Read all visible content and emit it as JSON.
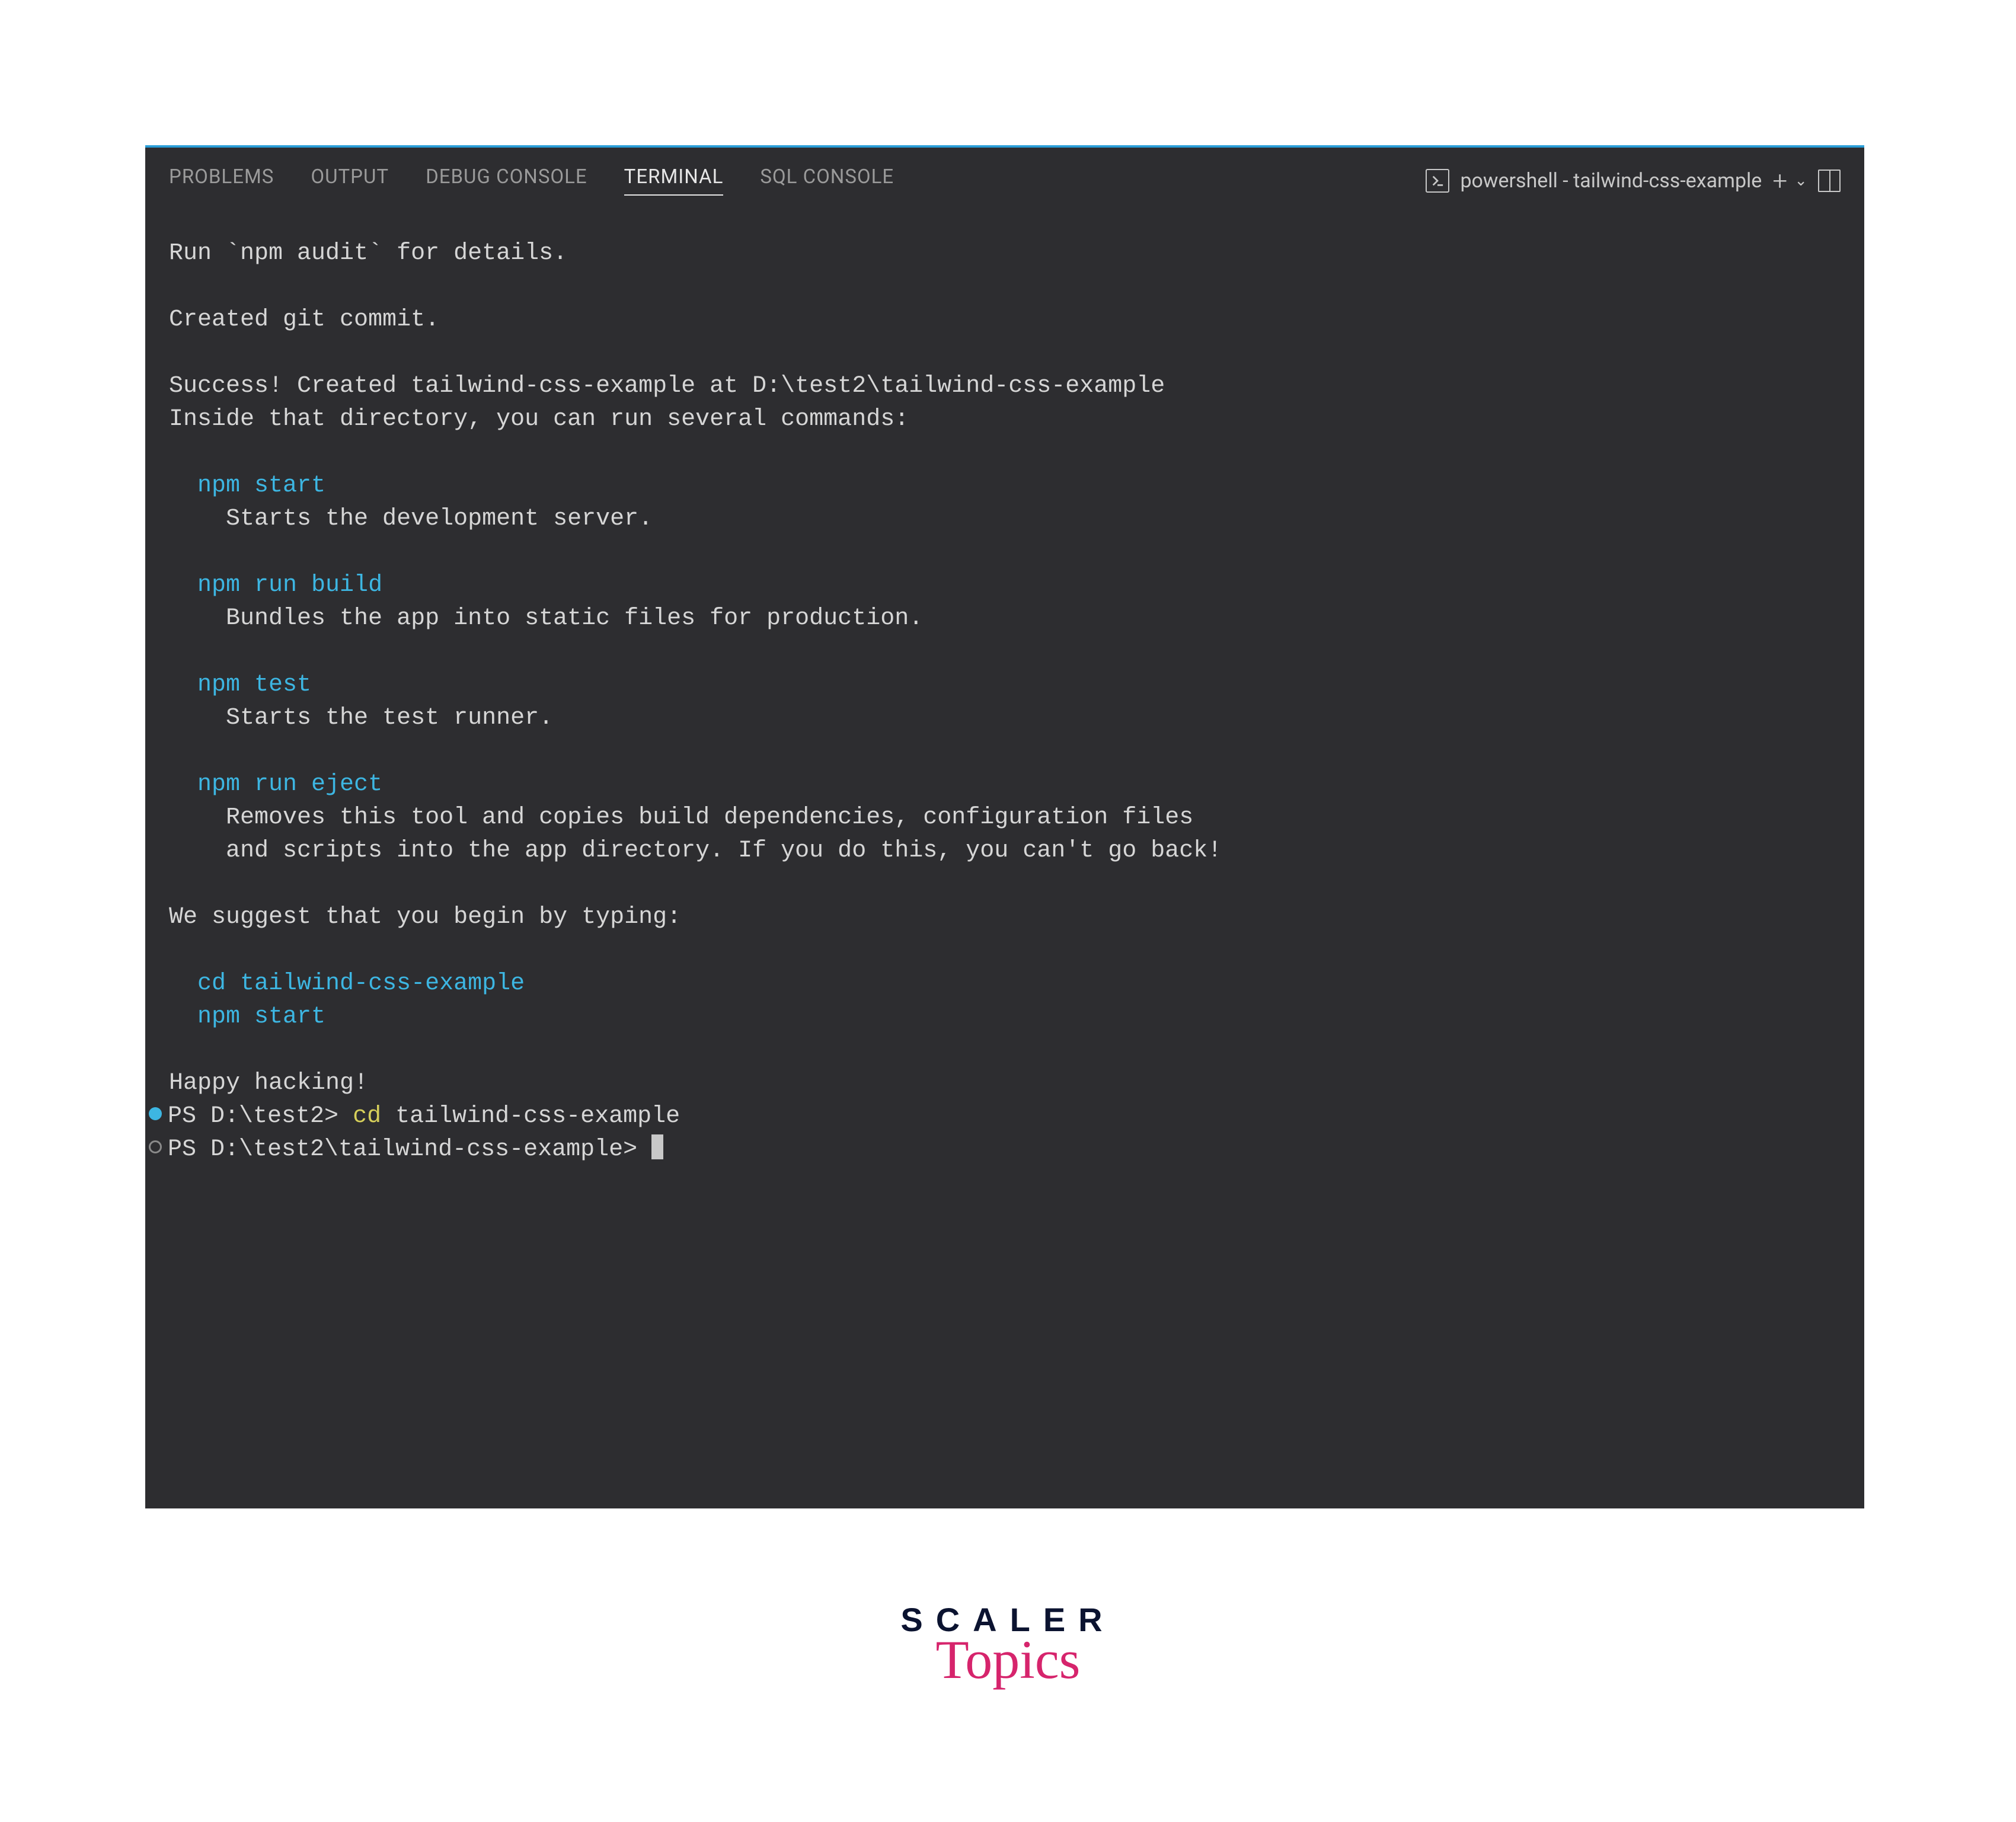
{
  "tabs": {
    "problems": "PROBLEMS",
    "output": "OUTPUT",
    "debug": "DEBUG CONSOLE",
    "terminal": "TERMINAL",
    "sql": "SQL CONSOLE"
  },
  "terminal_label": "powershell - tailwind-css-example",
  "lines": {
    "l1a": "Run `",
    "l1b": "npm audit",
    "l1c": "` for details.",
    "l2": "Created git commit.",
    "l3": "Success! Created tailwind-css-example at D:\\test2\\tailwind-css-example",
    "l4": "Inside that directory, you can run several commands:",
    "c1": "npm start",
    "d1": "Starts the development server.",
    "c2": "npm run build",
    "d2": "Bundles the app into static files for production.",
    "c3": "npm test",
    "d3": "Starts the test runner.",
    "c4": "npm run eject",
    "d4a": "Removes this tool and copies build dependencies, configuration files",
    "d4b": "and scripts into the app directory. If you do this, you can't go back!",
    "l5": "We suggest that you begin by typing:",
    "c5": "cd tailwind-css-example",
    "c6": "npm start",
    "l6": "Happy hacking!",
    "p1a": "PS D:\\test2> ",
    "p1b": "cd ",
    "p1c": "tailwind-css-example",
    "p2": "PS D:\\test2\\tailwind-css-example> "
  },
  "brand": {
    "top": "SCALER",
    "bottom": "Topics"
  }
}
